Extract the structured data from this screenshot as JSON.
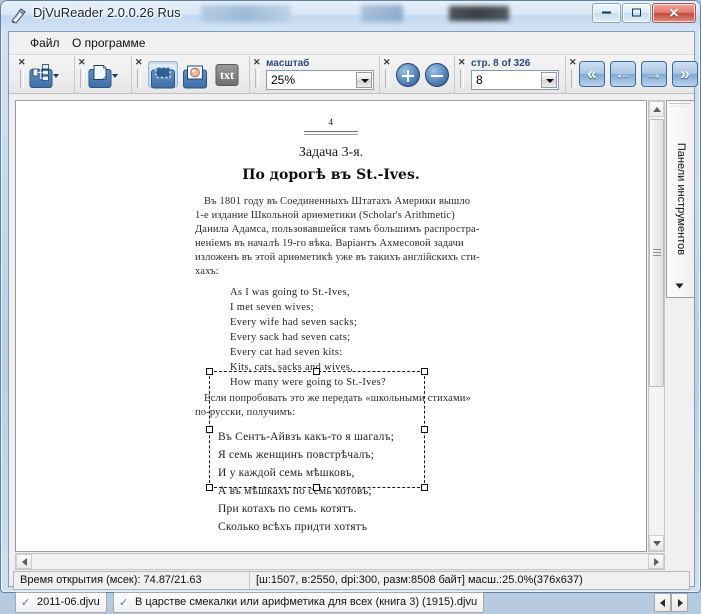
{
  "window": {
    "title": "DjVuReader 2.0.0.26 Rus",
    "icon": "djvu-app-icon",
    "minimize_label": "Minimize",
    "maximize_label": "Maximize",
    "close_label": "✕"
  },
  "menu": {
    "items": [
      {
        "label": "Файл"
      },
      {
        "label": "О программе"
      }
    ]
  },
  "toolbar": {
    "close_mark": "✕",
    "groups": [
      {
        "name": "layout-group",
        "icon": "page-layout-icon",
        "has_dropdown": true
      },
      {
        "name": "page-view-group",
        "icon": "single-page-icon",
        "has_dropdown": true
      },
      {
        "name": "tools-group",
        "buttons": [
          "select-region-icon",
          "image-mode-icon",
          "txt"
        ]
      },
      {
        "name": "zoom-group",
        "label": "масштаб",
        "value": "25%"
      },
      {
        "name": "zoom-step-group",
        "buttons": [
          "zoom-in-icon",
          "zoom-out-icon"
        ]
      },
      {
        "name": "page-group",
        "label": "стр. 8 of 326",
        "value": "8"
      },
      {
        "name": "nav-group",
        "buttons": [
          "first-page-icon",
          "prev-page-icon",
          "next-page-icon",
          "last-page-icon"
        ]
      }
    ],
    "txt_button_label": "txt",
    "zoom_label": "масштаб",
    "zoom_value": "25%",
    "page_label": "стр. 8 of 326",
    "page_value": "8",
    "nav_first": "«",
    "nav_prev": "←",
    "nav_next": "→",
    "nav_last": "»"
  },
  "side_panel": {
    "label": "Панели инструментов"
  },
  "document": {
    "folio": "4",
    "task_title": "Задача 3-я.",
    "poem_title": "По дорогѣ въ St.-Ives.",
    "intro_lines": [
      "Въ 1801 году въ Соединенныхъ Штатахъ Америки вышло",
      "1-е издание Школьной ариѳметики (Scholar's   Arithmetic)",
      "Данила Адамса, пользовавшейся тамъ большимъ распростра-",
      "неніемъ въ началѣ 19-го вѣка. Варіантъ Ахмесовой задачи",
      "изложенъ въ этой ариѳметикѣ уже въ такихъ англійскихъ сти-",
      "хахъ:"
    ],
    "verse_en": [
      "As I was going to St.-Ives,",
      "I met seven wives;",
      "Every wife had seven sacks;",
      "Every sack had seven cats;",
      "Every cat had seven kits:",
      "Kits, cats, sacks and wives,",
      "How many were going to St.-Ives?"
    ],
    "middle_lines": [
      "Если попробовать это же передать «школьными стихами»",
      "по-русски, получимъ:"
    ],
    "verse_ru": [
      "Въ Сентъ-Айвзъ какъ-то я шагалъ;",
      "Я семь женщинъ повстрѣчалъ;",
      "И у каждой семь мѣшковъ,",
      "А въ мѣшкахъ по семь котовъ;",
      "При котахъ по семь котятъ.",
      "Сколько всѣхъ придти хотятъ"
    ]
  },
  "status": {
    "left": "Время открытия (мсек): 74.87/21.63",
    "right": "[ш:1507, в:2550, dpi:300, разм:8508 байт] масш.:25.0%(376х637)"
  },
  "tabs": {
    "items": [
      {
        "label": "2011-06.djvu",
        "icon": "djvu-doc-icon",
        "active": false
      },
      {
        "label": "В царстве смекалки или арифметика для всех (книга 3) (1915).djvu",
        "icon": "djvu-doc-icon",
        "active": true
      }
    ],
    "scroll_left": "◀",
    "scroll_right": "▶"
  }
}
